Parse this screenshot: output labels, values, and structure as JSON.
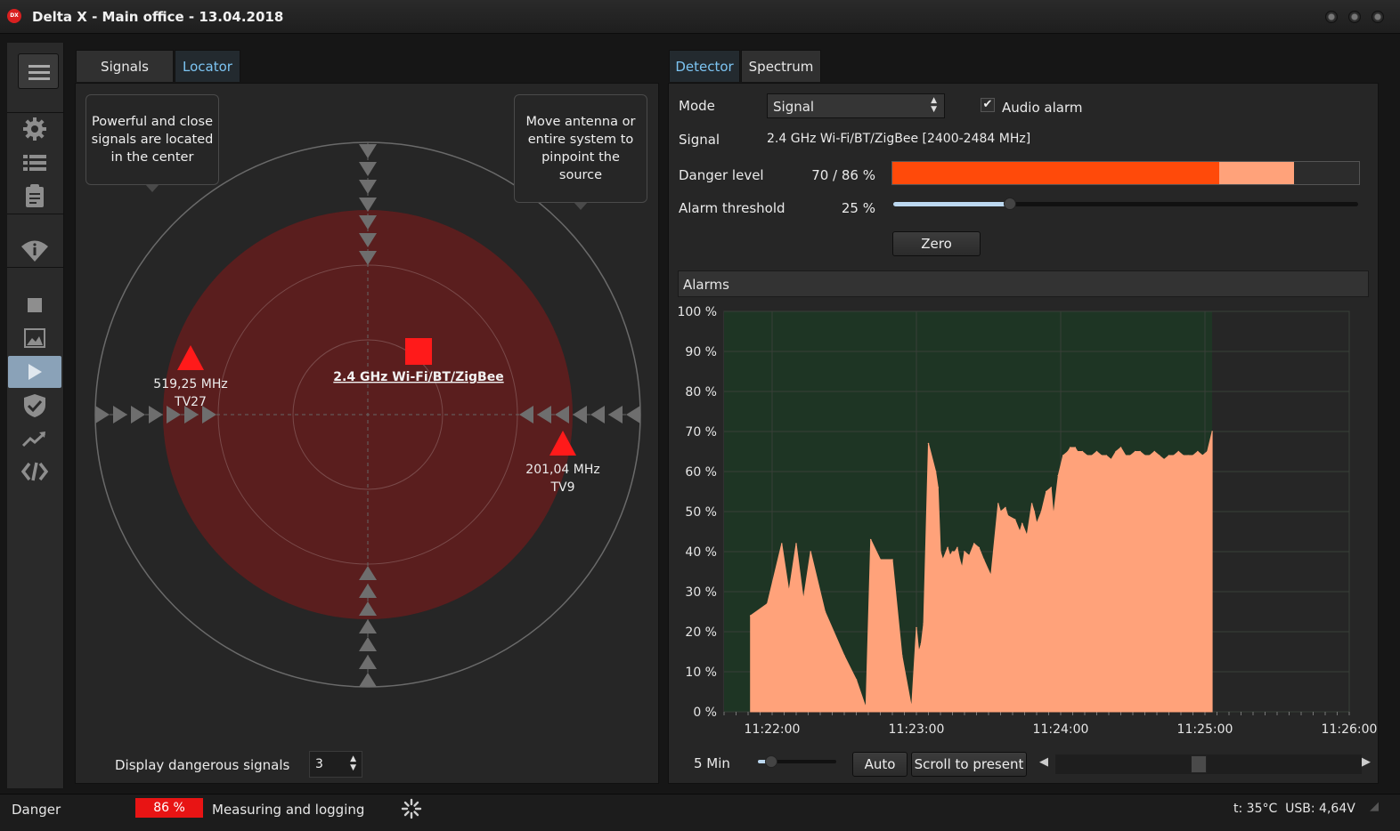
{
  "window": {
    "title": "Delta X - Main office - 13.04.2018",
    "logo_text": "DX"
  },
  "left_panel": {
    "tabs": [
      {
        "label": "Signals",
        "active": false
      },
      {
        "label": "Locator",
        "active": true
      }
    ],
    "tooltip_left": "Powerful and close signals are located in the center",
    "tooltip_right": "Move antenna or entire system to pinpoint the source",
    "center_signal": "2.4 GHz Wi-Fi/BT/ZigBee",
    "signals": [
      {
        "freq": "519,25 MHz",
        "name": "TV27"
      },
      {
        "freq": "201,04 MHz",
        "name": "TV9"
      }
    ],
    "display_label": "Display dangerous signals",
    "display_count": "3"
  },
  "right_panel": {
    "tabs": [
      {
        "label": "Detector",
        "active": true
      },
      {
        "label": "Spectrum",
        "active": false
      }
    ],
    "mode_label": "Mode",
    "mode_value": "Signal",
    "audio_alarm_label": "Audio alarm",
    "audio_alarm_checked": true,
    "signal_label": "Signal",
    "signal_value": "2.4 GHz Wi-Fi/BT/ZigBee [2400-2484 MHz]",
    "danger_label": "Danger level",
    "danger_value": "70 / 86 %",
    "danger_current_pct": 70,
    "danger_peak_pct": 86,
    "threshold_label": "Alarm threshold",
    "threshold_value": "25 %",
    "threshold_pct": 25,
    "zero_label": "Zero",
    "alarms_title": "Alarms",
    "window_label": "5 Min",
    "auto_label": "Auto",
    "scroll_label": "Scroll to present"
  },
  "chart_data": {
    "type": "area",
    "y_ticks": [
      "100 %",
      "90 %",
      "80 %",
      "70 %",
      "60 %",
      "50 %",
      "40 %",
      "30 %",
      "20 %",
      "10 %",
      "0 %"
    ],
    "x_ticks": [
      "11:22:00",
      "11:23:00",
      "11:24:00",
      "11:25:00",
      "11:26:00"
    ],
    "xlim": [
      "11:21:40",
      "11:26:00"
    ],
    "ylim": [
      0,
      100
    ],
    "alarm_active_range": [
      "11:21:40",
      "11:25:03"
    ],
    "series": [
      {
        "x": [
          "11:21:51",
          "11:21:58",
          "11:22:04",
          "11:22:07",
          "11:22:10",
          "11:22:13",
          "11:22:16",
          "11:22:22",
          "11:22:30",
          "11:22:35",
          "11:22:39",
          "11:22:41",
          "11:22:45",
          "11:22:50",
          "11:22:54",
          "11:22:58",
          "11:22:58",
          "11:23:00",
          "11:23:01",
          "11:23:02",
          "11:23:03",
          "11:23:05",
          "11:23:08",
          "11:23:09",
          "11:23:10",
          "11:23:11",
          "11:23:13",
          "11:23:14",
          "11:23:15",
          "11:23:16",
          "11:23:17",
          "11:23:18",
          "11:23:19",
          "11:23:20",
          "11:23:22",
          "11:23:24",
          "11:23:26",
          "11:23:28",
          "11:23:31",
          "11:23:34",
          "11:23:35",
          "11:23:37",
          "11:23:38",
          "11:23:41",
          "11:23:43",
          "11:23:44",
          "11:23:46",
          "11:23:48",
          "11:23:49",
          "11:23:50",
          "11:23:52",
          "11:23:54",
          "11:23:56",
          "11:23:57",
          "11:23:59",
          "11:24:01",
          "11:24:03",
          "11:24:04",
          "11:24:06",
          "11:24:07",
          "11:24:09",
          "11:24:11",
          "11:24:13",
          "11:24:15",
          "11:24:17",
          "11:24:19",
          "11:24:21",
          "11:24:23",
          "11:24:25",
          "11:24:27",
          "11:24:29",
          "11:24:31",
          "11:24:33",
          "11:24:35",
          "11:24:37",
          "11:24:39",
          "11:24:41",
          "11:24:43",
          "11:24:45",
          "11:24:47",
          "11:24:49",
          "11:24:51",
          "11:24:53",
          "11:24:55",
          "11:24:57",
          "11:24:59",
          "11:25:01",
          "11:25:03"
        ],
        "y": [
          24,
          27,
          42,
          30,
          42,
          28,
          40,
          25,
          14,
          8,
          1,
          43,
          38,
          38,
          14,
          1,
          1,
          21,
          15,
          17,
          22,
          67,
          60,
          56,
          40,
          38,
          41,
          39,
          40,
          40,
          41,
          38,
          36,
          40,
          39,
          42,
          41,
          38,
          34,
          52,
          50,
          51,
          49,
          48,
          45,
          47,
          44,
          52,
          50,
          47,
          50,
          55,
          56,
          49,
          59,
          64,
          65,
          66,
          66,
          65,
          65,
          64,
          64,
          65,
          64,
          64,
          63,
          65,
          66,
          64,
          64,
          65,
          65,
          64,
          64,
          65,
          64,
          63,
          64,
          64,
          65,
          64,
          64,
          64,
          65,
          64,
          65,
          70
        ]
      }
    ]
  },
  "status": {
    "state_label": "Danger",
    "danger_badge": "86 %",
    "activity": "Measuring and logging",
    "telemetry": "t: 35°C  USB: 4,64V"
  }
}
